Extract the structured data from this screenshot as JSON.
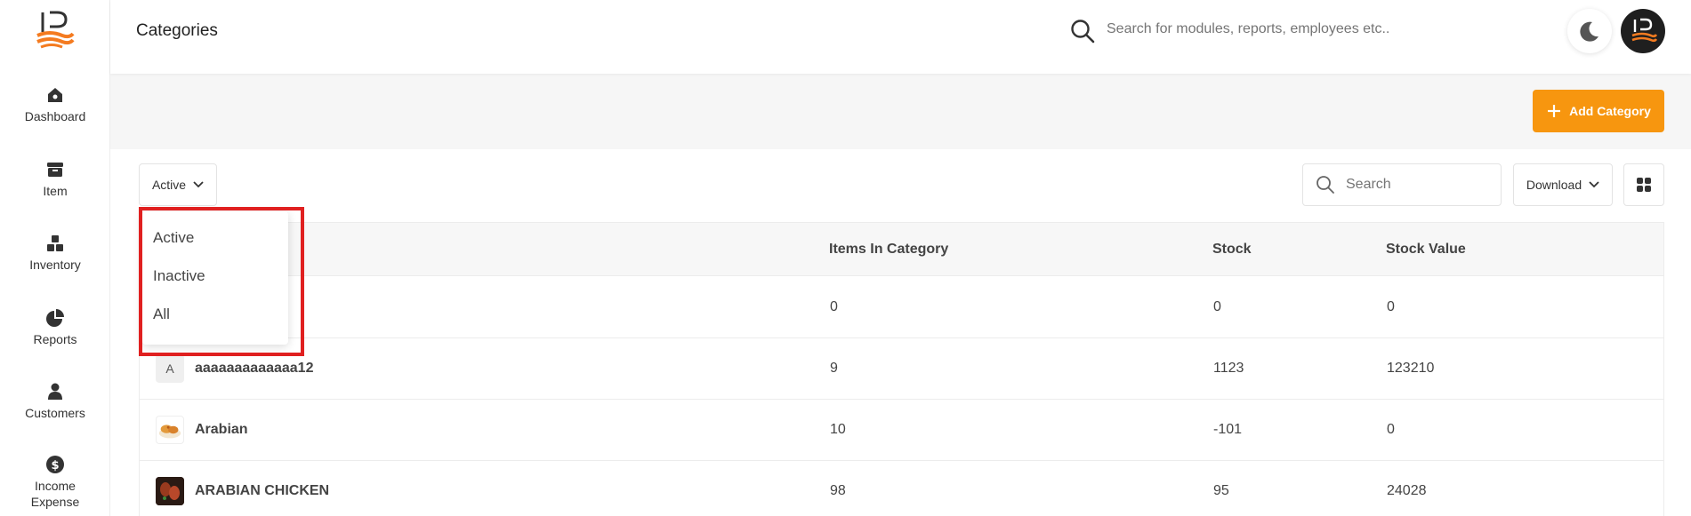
{
  "header": {
    "title": "Categories",
    "search_placeholder": "Search for modules, reports, employees etc.."
  },
  "sidebar": {
    "items": [
      {
        "label": "Dashboard",
        "icon": "home-icon"
      },
      {
        "label": "Item",
        "icon": "archive-icon"
      },
      {
        "label": "Inventory",
        "icon": "boxes-icon"
      },
      {
        "label": "Reports",
        "icon": "pie-chart-icon"
      },
      {
        "label": "Customers",
        "icon": "user-icon"
      },
      {
        "label": "Income Expense",
        "icon": "dollar-icon"
      }
    ]
  },
  "toolbar": {
    "add_label": "Add Category",
    "status_selected": "Active",
    "search_placeholder": "Search",
    "download_label": "Download"
  },
  "dropdown": {
    "options": [
      "Active",
      "Inactive",
      "All"
    ]
  },
  "table": {
    "columns": [
      "Items In Category",
      "Stock",
      "Stock Value"
    ],
    "rows": [
      {
        "thumb": "",
        "name": "",
        "items": "0",
        "stock": "0",
        "value": "0"
      },
      {
        "thumb": "A",
        "name": "aaaaaaaaaaaaa12",
        "items": "9",
        "stock": "1123",
        "value": "123210"
      },
      {
        "thumb": "",
        "name": "Arabian",
        "items": "10",
        "stock": "-101",
        "value": "0"
      },
      {
        "thumb": "",
        "name": "ARABIAN CHICKEN",
        "items": "98",
        "stock": "95",
        "value": "24028"
      }
    ]
  },
  "colors": {
    "accent": "#f7960f",
    "highlight": "#e02020",
    "avatar_bg": "#1f1f1f"
  }
}
